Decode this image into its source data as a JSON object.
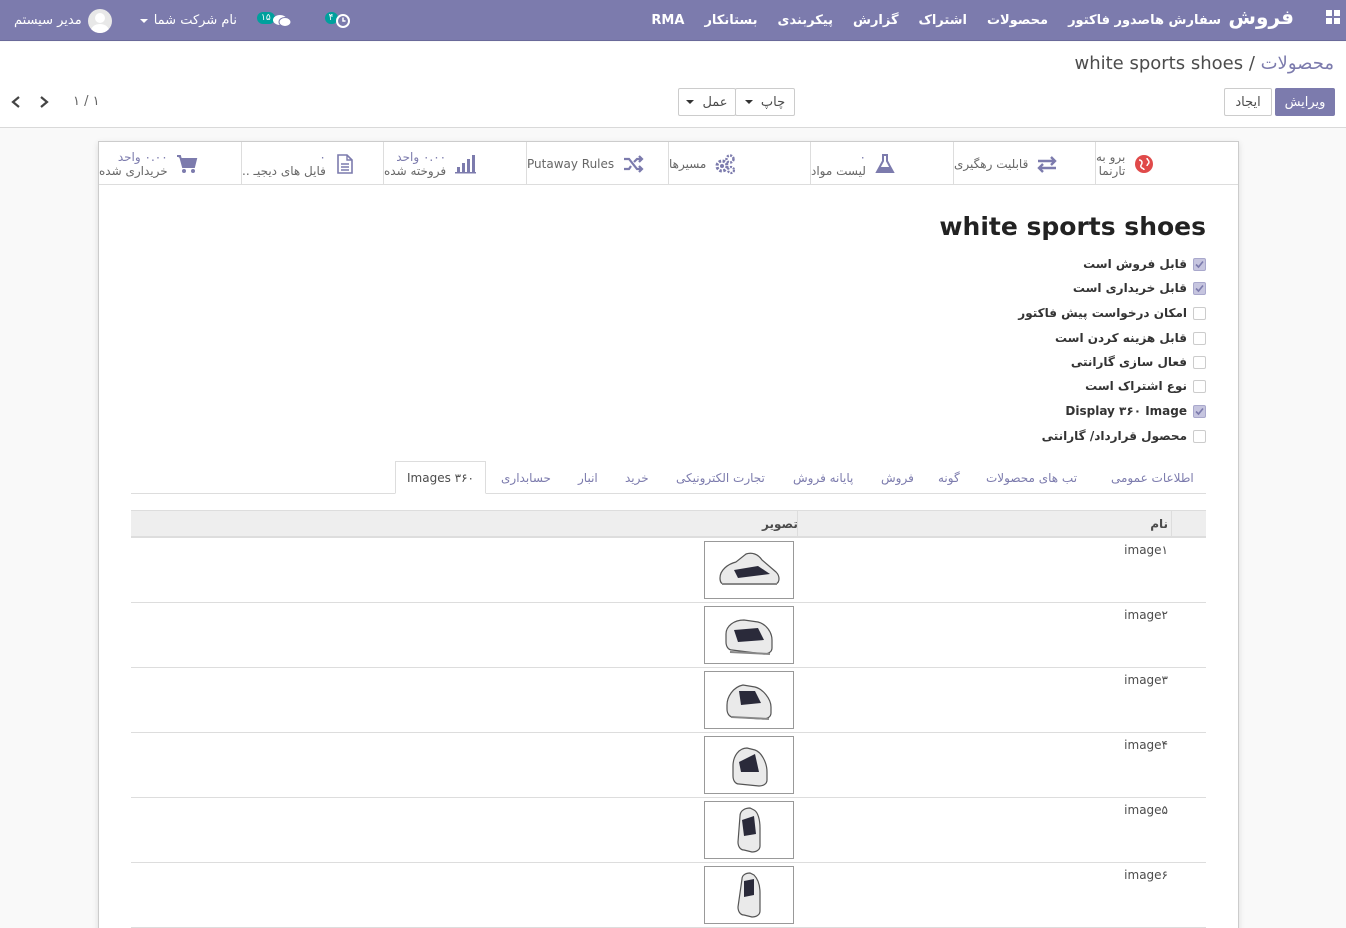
{
  "navbar": {
    "brand": "فروش",
    "menu": [
      "سفارش ها",
      "صدور فاکتور",
      "محصولات",
      "اشتراک",
      "گزارش",
      "پیکربندی",
      "بستانکار",
      "RMA"
    ],
    "activity_count": "۴",
    "message_count": "۱۵",
    "company": "نام شرکت شما",
    "user": "مدیر سیستم"
  },
  "control_panel": {
    "breadcrumb_parent": "محصولات",
    "breadcrumb_sep": " / ",
    "breadcrumb_current": "white sports shoes",
    "edit_label": "ویرایش",
    "create_label": "ایجاد",
    "print_label": "چاپ",
    "action_label": "عمل",
    "pager": "۱ / ۱"
  },
  "smart_buttons": [
    {
      "label": "برو به",
      "label2": "تارنما",
      "icon": "globe-icon"
    },
    {
      "label": "قابلیت رهگیری",
      "label2": "",
      "icon": "exchange-icon"
    },
    {
      "label": "۰",
      "label2": "لیست مواد",
      "icon": "flask-icon"
    },
    {
      "label": "مسیرها",
      "label2": "",
      "icon": "cogs-icon"
    },
    {
      "label": "Putaway Rules",
      "label2": "",
      "icon": "random-icon"
    },
    {
      "label": "۰.۰۰ واحد",
      "label2": "فروخته شده",
      "icon": "bar-chart-icon"
    },
    {
      "label": "۰",
      "label2": "فایل های دیجیـ ..",
      "icon": "file-icon"
    },
    {
      "label": "۰.۰۰ واحد",
      "label2": "خریداری شده",
      "icon": "cart-icon"
    }
  ],
  "product": {
    "name": "white sports shoes",
    "options": [
      {
        "label": "قابل فروش است",
        "checked": true
      },
      {
        "label": "قابل خریداری است",
        "checked": true
      },
      {
        "label": "امکان درخواست پیش فاکتور",
        "checked": false
      },
      {
        "label": "قابل هزینه کردن است",
        "checked": false
      },
      {
        "label": "فعال سازی گارانتی",
        "checked": false
      },
      {
        "label": "نوع اشتراک است",
        "checked": false
      },
      {
        "label": "Display ۳۶۰ Image",
        "checked": true
      },
      {
        "label": "محصول قرارداد/ گارانتی",
        "checked": false
      }
    ]
  },
  "tabs": [
    "اطلاعات عمومی",
    "تب های محصولات",
    "گونه",
    "فروش",
    "پایانه فروش",
    "تجارت الکترونیکی",
    "خرید",
    "انبار",
    "حسابداری",
    "Images ۳۶۰"
  ],
  "table": {
    "col_name": "نام",
    "col_image": "تصویر",
    "rows": [
      "image۱",
      "image۲",
      "image۳",
      "image۴",
      "image۵",
      "image۶"
    ]
  },
  "colors": {
    "brand": "#7c7bad",
    "teal": "#00a09d"
  }
}
